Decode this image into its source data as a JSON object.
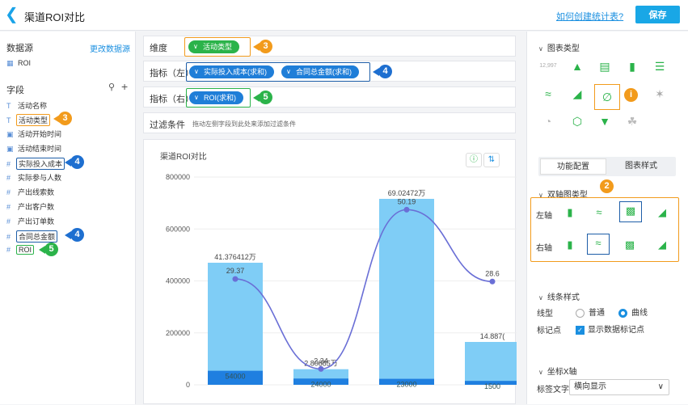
{
  "header": {
    "title": "渠道ROI对比",
    "help_link": "如何创建统计表?",
    "save_label": "保存"
  },
  "left": {
    "datasource_label": "数据源",
    "change_source": "更改数据源",
    "source_name": "ROI",
    "fields_label": "字段",
    "fields": [
      {
        "icon": "T",
        "label": "活动名称"
      },
      {
        "icon": "T",
        "label": "活动类型"
      },
      {
        "icon": "cal",
        "label": "活动开始时间"
      },
      {
        "icon": "cal",
        "label": "活动结束时间"
      },
      {
        "icon": "#",
        "label": "实际投入成本"
      },
      {
        "icon": "#",
        "label": "实际参与人数"
      },
      {
        "icon": "#",
        "label": "产出线索数"
      },
      {
        "icon": "#",
        "label": "产出客户数"
      },
      {
        "icon": "#",
        "label": "产出订单数"
      },
      {
        "icon": "#",
        "label": "合同总金额"
      },
      {
        "icon": "#",
        "label": "ROI"
      }
    ]
  },
  "config": {
    "dimension_label": "维度",
    "dimension_pill": "活动类型",
    "metric_left_label": "指标（左）",
    "metric_left_pills": [
      "实际投入成本(求和)",
      "合同总金额(求和)"
    ],
    "metric_right_label": "指标（右）",
    "metric_right_pill": "ROI(求和)",
    "filter_label": "过滤条件",
    "filter_hint": "拖动左侧字段到此处来添加过滤条件"
  },
  "badges": {
    "b2": "2",
    "b3": "3",
    "b4": "4",
    "b5": "5"
  },
  "chart_data": {
    "type": "bar",
    "title": "渠道ROI对比",
    "ylim": [
      0,
      800000
    ],
    "yticks": [
      "800000",
      "600000",
      "400000",
      "200000",
      "0"
    ],
    "series": [
      {
        "values": [
          470000,
          60000,
          716000,
          165000
        ],
        "labels": [
          "41.376412万",
          "2.80885万",
          "69.02472万",
          "14.887("
        ]
      },
      {
        "values": [
          54000,
          24000,
          23000,
          15000
        ],
        "labels": [
          "54000",
          "24000",
          "23000",
          "1500"
        ]
      },
      {
        "values": [
          29.37,
          2.34,
          50.19,
          28.6
        ],
        "labels": [
          "29.37",
          "2.34",
          "50.19",
          "28.6"
        ]
      }
    ],
    "colors": {
      "bar_light": "#7fcdf6",
      "bar_dark": "#1f7fe0",
      "line": "#6a6fd6"
    }
  },
  "right": {
    "chart_type_label": "图表类型",
    "number_card": "12,997",
    "tab_active": "功能配置",
    "tab_inactive": "图表样式",
    "dual_axis_label": "双轴图类型",
    "left_axis": "左轴",
    "right_axis": "右轴",
    "line_style_label": "线条样式",
    "line_type_label": "线型",
    "opt_normal": "普通",
    "opt_curve": "曲线",
    "marker_label": "标记点",
    "marker_check": "显示数据标记点",
    "xaxis_label": "坐标X轴",
    "tick_text_label": "标签文字",
    "tick_text_value": "横向显示"
  }
}
